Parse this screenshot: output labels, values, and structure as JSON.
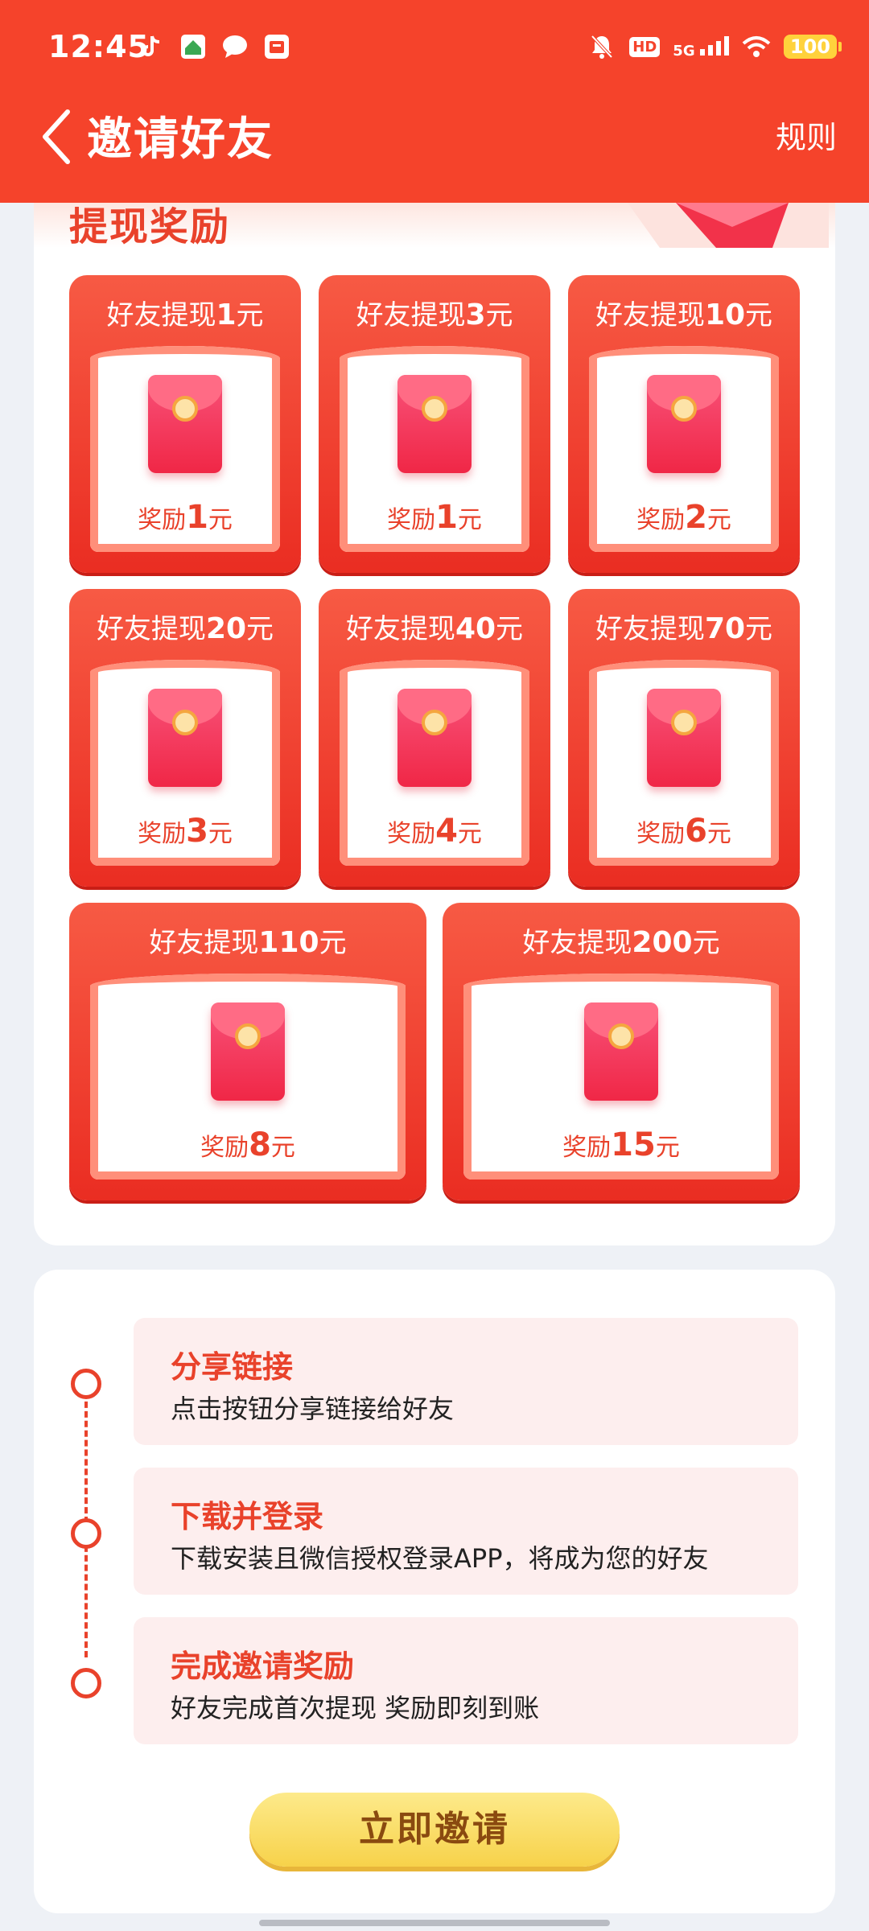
{
  "status_bar": {
    "time": "12:45",
    "hd": "HD",
    "network": "5G",
    "battery": "100"
  },
  "nav": {
    "title": "邀请好友",
    "rules": "规则"
  },
  "rewards": {
    "section_title": "提现奖励",
    "tiles": [
      {
        "head_prefix": "好友提现",
        "head_amount": "1",
        "head_unit": "元",
        "reward_prefix": "奖励",
        "reward_amount": "1",
        "reward_unit": "元"
      },
      {
        "head_prefix": "好友提现",
        "head_amount": "3",
        "head_unit": "元",
        "reward_prefix": "奖励",
        "reward_amount": "1",
        "reward_unit": "元"
      },
      {
        "head_prefix": "好友提现",
        "head_amount": "10",
        "head_unit": "元",
        "reward_prefix": "奖励",
        "reward_amount": "2",
        "reward_unit": "元"
      },
      {
        "head_prefix": "好友提现",
        "head_amount": "20",
        "head_unit": "元",
        "reward_prefix": "奖励",
        "reward_amount": "3",
        "reward_unit": "元"
      },
      {
        "head_prefix": "好友提现",
        "head_amount": "40",
        "head_unit": "元",
        "reward_prefix": "奖励",
        "reward_amount": "4",
        "reward_unit": "元"
      },
      {
        "head_prefix": "好友提现",
        "head_amount": "70",
        "head_unit": "元",
        "reward_prefix": "奖励",
        "reward_amount": "6",
        "reward_unit": "元"
      },
      {
        "head_prefix": "好友提现",
        "head_amount": "110",
        "head_unit": "元",
        "reward_prefix": "奖励",
        "reward_amount": "8",
        "reward_unit": "元"
      },
      {
        "head_prefix": "好友提现",
        "head_amount": "200",
        "head_unit": "元",
        "reward_prefix": "奖励",
        "reward_amount": "15",
        "reward_unit": "元"
      }
    ]
  },
  "steps": [
    {
      "title": "分享链接",
      "desc": "点击按钮分享链接给好友"
    },
    {
      "title": "下载并登录",
      "desc": "下载安装且微信授权登录APP，将成为您的好友"
    },
    {
      "title": "完成邀请奖励",
      "desc": "好友完成首次提现 奖励即刻到账"
    }
  ],
  "invite_button": "立即邀请",
  "colors": {
    "header": "#f5432b",
    "accent": "#e9422b",
    "button": "#f7d24a"
  }
}
